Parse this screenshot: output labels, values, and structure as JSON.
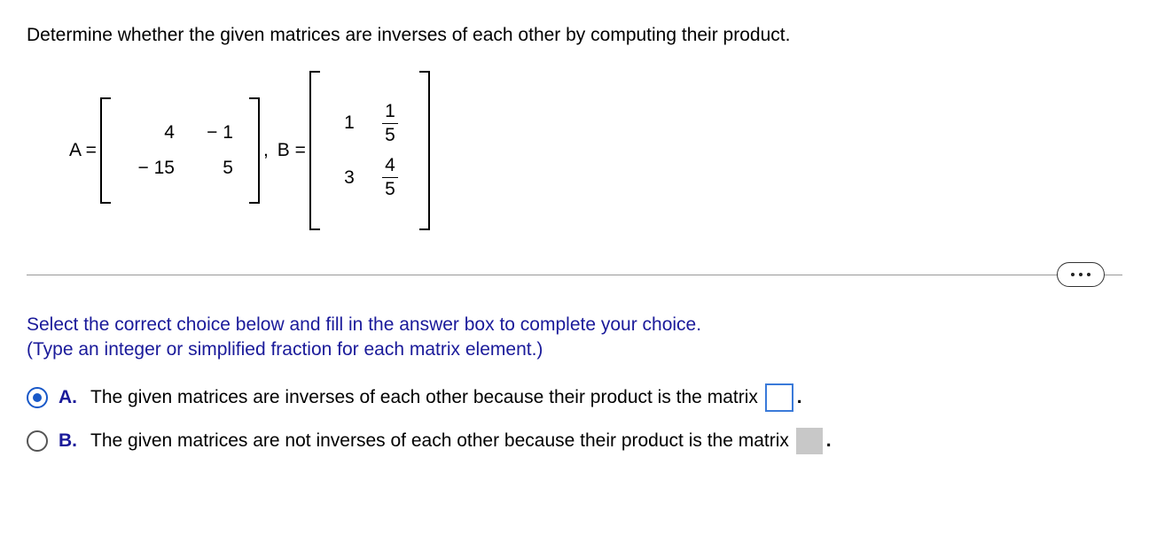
{
  "question": "Determine whether the given matrices are inverses of each other by computing their product.",
  "matrices": {
    "A": {
      "label": "A =",
      "rows": [
        [
          "4",
          "− 1"
        ],
        [
          "− 15",
          "5"
        ]
      ]
    },
    "comma": ",",
    "B": {
      "label": "B =",
      "rows": [
        {
          "left": "1",
          "frac": {
            "num": "1",
            "den": "5"
          }
        },
        {
          "left": "3",
          "frac": {
            "num": "4",
            "den": "5"
          }
        }
      ]
    }
  },
  "instruction_line1": "Select the correct choice below and fill in the answer box to complete your choice.",
  "instruction_line2": "(Type an integer or simplified fraction for each matrix element.)",
  "choices": {
    "A": {
      "letter": "A.",
      "text": "The given matrices are inverses of each other because their product is the matrix",
      "selected": true
    },
    "B": {
      "letter": "B.",
      "text": "The given matrices are not inverses of each other because their product is the matrix",
      "selected": false
    }
  },
  "period": "."
}
